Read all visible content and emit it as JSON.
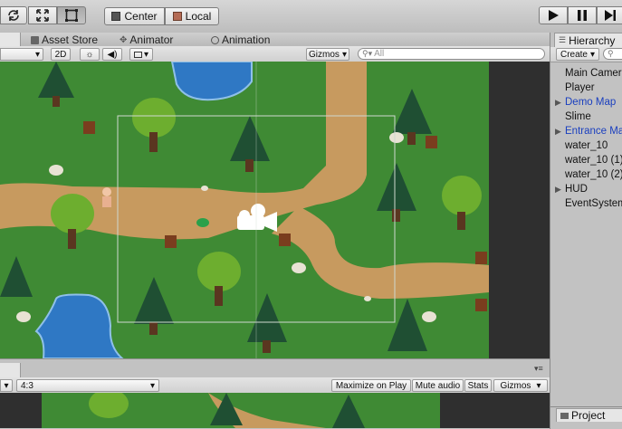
{
  "toolbar": {
    "pivot_label": "Center",
    "space_label": "Local"
  },
  "scene_tabs": {
    "asset_store": "Asset Store",
    "animator": "Animator",
    "animation": "Animation"
  },
  "scene_bar": {
    "mode_2d": "2D",
    "gizmos_label": "Gizmos",
    "search_placeholder": "All"
  },
  "hierarchy": {
    "tab_label": "Hierarchy",
    "create_label": "Create",
    "items": [
      {
        "label": "Main Camera",
        "arrow": "",
        "color": "#111111"
      },
      {
        "label": "Player",
        "arrow": "",
        "color": "#111111"
      },
      {
        "label": "Demo Map",
        "arrow": "▶",
        "color": "#1a3fbf"
      },
      {
        "label": "Slime",
        "arrow": "",
        "color": "#111111"
      },
      {
        "label": "Entrance Map",
        "arrow": "▶",
        "color": "#1a3fbf"
      },
      {
        "label": "water_10",
        "arrow": "",
        "color": "#111111"
      },
      {
        "label": "water_10 (1)",
        "arrow": "",
        "color": "#111111"
      },
      {
        "label": "water_10 (2)",
        "arrow": "",
        "color": "#111111"
      },
      {
        "label": "HUD",
        "arrow": "▶",
        "color": "#111111"
      },
      {
        "label": "EventSystem",
        "arrow": "",
        "color": "#111111"
      }
    ]
  },
  "game_bar": {
    "aspect": "4:3",
    "maximize": "Maximize on Play",
    "mute": "Mute audio",
    "stats": "Stats",
    "gizmos": "Gizmos"
  },
  "project": {
    "tab_label": "Project"
  },
  "colors": {
    "grass": "#3f8a34",
    "path": "#c79a5f",
    "water": "#2f78c4",
    "dark_panel": "#2f2f2f"
  }
}
